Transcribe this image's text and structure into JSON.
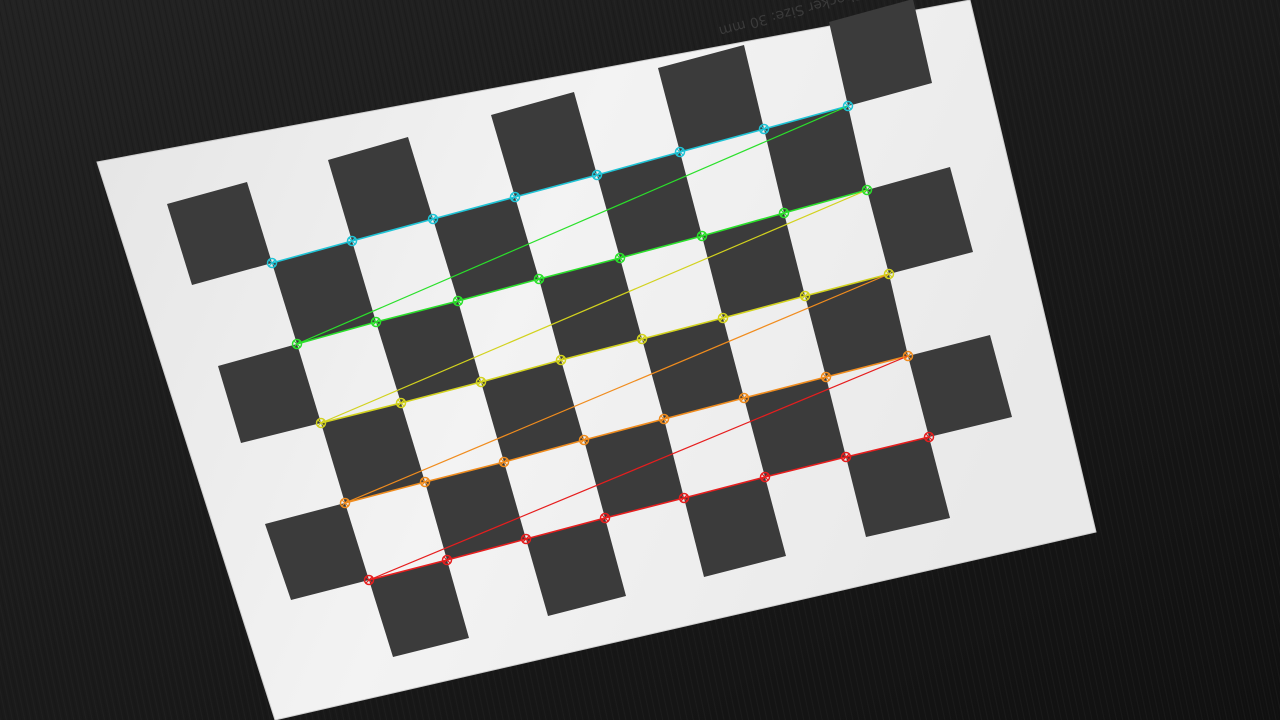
{
  "image": {
    "paper_label": "Checker Size: 30 mm",
    "board": {
      "inner_columns": 8,
      "inner_rows": 5
    }
  },
  "detected_corners": {
    "row_colors": [
      "#1fc4d6",
      "#2be02b",
      "#d2d21e",
      "#f08c1e",
      "#e61e1e"
    ],
    "rows": [
      [
        [
          272,
          263
        ],
        [
          352,
          241
        ],
        [
          433,
          219
        ],
        [
          515,
          197
        ],
        [
          597,
          175
        ],
        [
          680,
          152
        ],
        [
          764,
          129
        ],
        [
          848,
          106
        ]
      ],
      [
        [
          297,
          344
        ],
        [
          376,
          322
        ],
        [
          458,
          301
        ],
        [
          539,
          279
        ],
        [
          620,
          258
        ],
        [
          702,
          236
        ],
        [
          784,
          213
        ],
        [
          867,
          190
        ]
      ],
      [
        [
          321,
          423
        ],
        [
          401,
          403
        ],
        [
          481,
          382
        ],
        [
          561,
          360
        ],
        [
          642,
          339
        ],
        [
          723,
          318
        ],
        [
          805,
          296
        ],
        [
          889,
          274
        ]
      ],
      [
        [
          345,
          503
        ],
        [
          425,
          482
        ],
        [
          504,
          462
        ],
        [
          584,
          440
        ],
        [
          664,
          419
        ],
        [
          744,
          398
        ],
        [
          826,
          377
        ],
        [
          908,
          356
        ]
      ],
      [
        [
          369,
          580
        ],
        [
          447,
          560
        ],
        [
          526,
          539
        ],
        [
          605,
          518
        ],
        [
          684,
          498
        ],
        [
          765,
          477
        ],
        [
          846,
          457
        ],
        [
          929,
          437
        ]
      ]
    ]
  }
}
